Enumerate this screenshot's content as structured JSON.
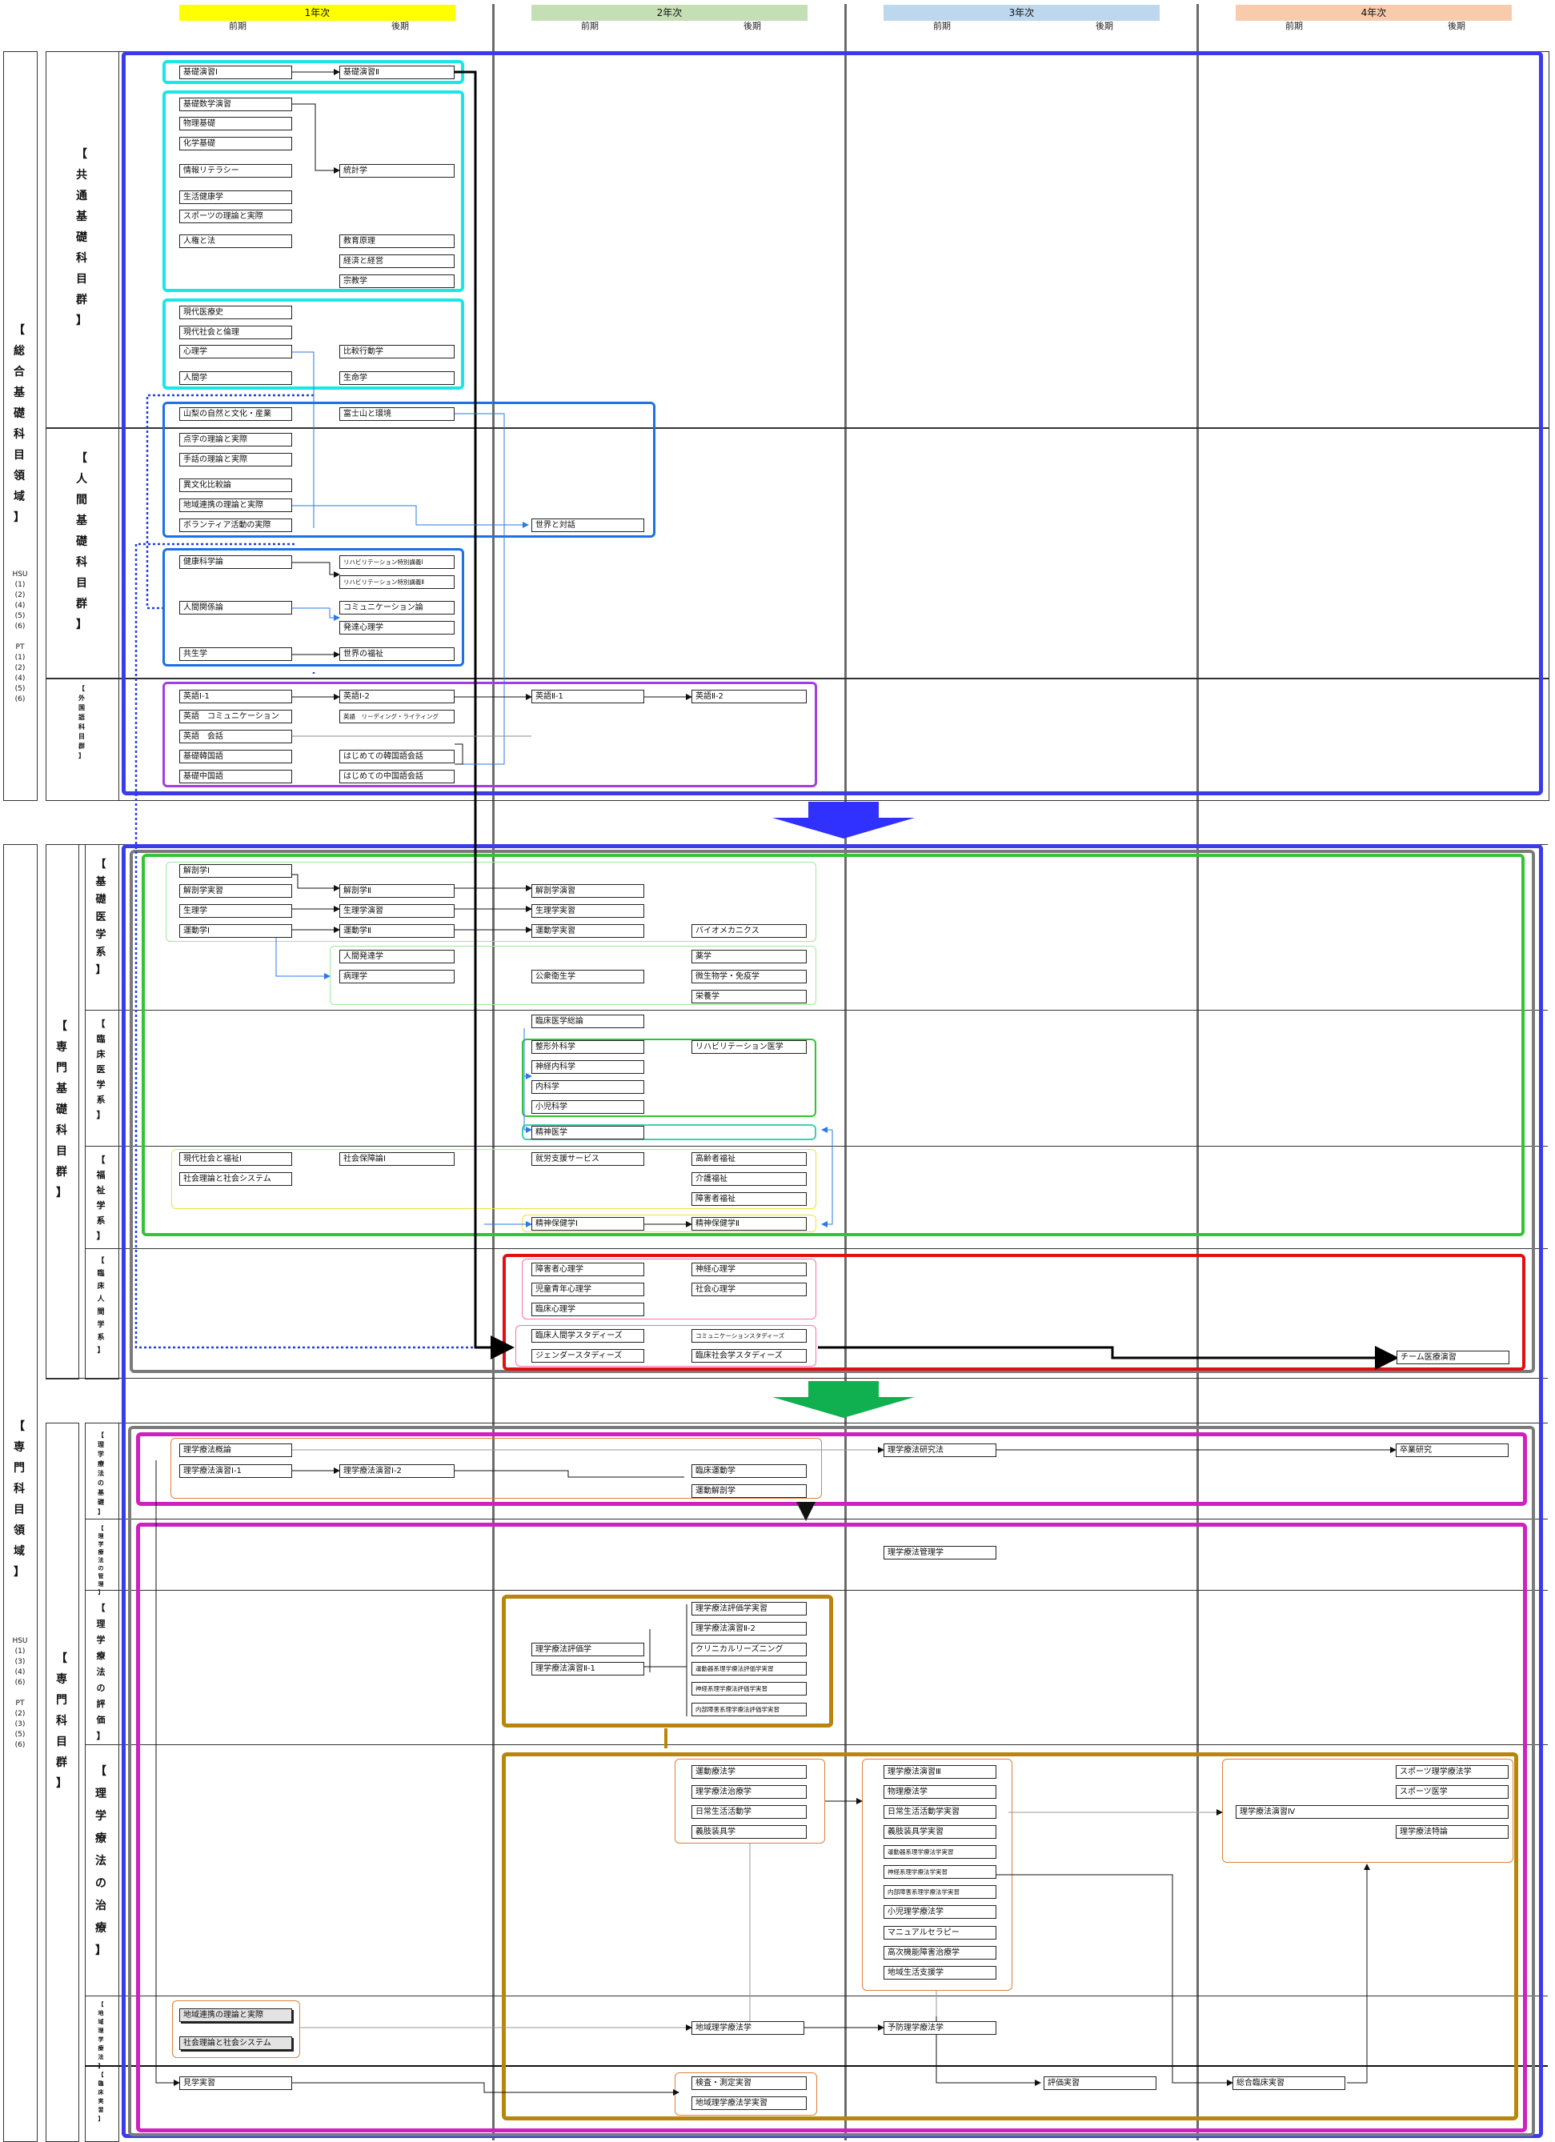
{
  "years": [
    {
      "label": "1年次",
      "color": "#ffff00",
      "sub1": "前期",
      "sub2": "後期"
    },
    {
      "label": "2年次",
      "color": "#c5dfb4",
      "sub1": "前期",
      "sub2": "後期"
    },
    {
      "label": "3年次",
      "color": "#bdd7ee",
      "sub1": "前期",
      "sub2": "後期"
    },
    {
      "label": "4年次",
      "color": "#f8cbad",
      "sub1": "前期",
      "sub2": "後期"
    }
  ],
  "domains": {
    "general": "【総合基礎科目領域】",
    "professional": "【専門科目領域】",
    "general_codes": "HSU\n(1)\n(2)\n(4)\n(5)\n(6)\n\nPT\n(1)\n(2)\n(4)\n(5)\n(6)",
    "professional_codes": "HSU\n(1)\n(3)\n(4)\n(6)\n\nPT\n(2)\n(3)\n(5)\n(6)"
  },
  "groups": {
    "common_basic": "【共通基礎科目群】",
    "human_basic": "【人間基礎科目群】",
    "foreign_lang": "【外国語科目群】",
    "prof_basic": "【専門基礎科目群】",
    "basic_medicine": "【基礎医学系】",
    "clinical_medicine": "【臨床医学系】",
    "welfare": "【福祉学系】",
    "clinical_human": "【臨床人間学系】",
    "prof_subjects": "【専門科目群】",
    "pt_basic": "【理学療法の基礎】",
    "pt_management": "【理学療法の管理】",
    "pt_evaluation": "【理学療法の評価】",
    "pt_treatment": "【理学療法の治療】",
    "community_pt": "【地域理学療法】",
    "clinical_practice": "【臨床実習】"
  },
  "courses": {
    "c1": "基礎演習Ⅰ",
    "c2": "基礎演習Ⅱ",
    "c3": "基礎数学演習",
    "c4": "物理基礎",
    "c5": "化学基礎",
    "c6": "情報リテラシー",
    "c7": "統計学",
    "c8": "生活健康学",
    "c9": "スポーツの理論と実際",
    "c10": "人権と法",
    "c11": "教育原理",
    "c12": "経済と経営",
    "c13": "宗教学",
    "c14": "現代医療史",
    "c15": "現代社会と倫理",
    "c16": "心理学",
    "c17": "比較行動学",
    "c18": "人間学",
    "c19": "生命学",
    "c20": "山梨の自然と文化・産業",
    "c21": "富士山と環境",
    "c22": "点字の理論と実際",
    "c23": "手話の理論と実際",
    "c24": "異文化比較論",
    "c25": "地域連携の理論と実際",
    "c26": "ボランティア活動の実際",
    "c27": "世界と対話",
    "c28": "健康科学論",
    "c29": "リハビリテーション特別講義Ⅰ",
    "c30": "リハビリテーション特別講義Ⅱ",
    "c31": "人間関係論",
    "c32": "コミュニケーション論",
    "c33": "発達心理学",
    "c34": "共生学",
    "c35": "世界の福祉",
    "c36": "英語Ⅰ-1",
    "c37": "英語Ⅰ-2",
    "c38": "英語Ⅱ-1",
    "c39": "英語Ⅱ-2",
    "c40": "英語　コミュニケーション",
    "c41": "英語　リーディング・ライティング",
    "c42": "英語　会話",
    "c43": "基礎韓国語",
    "c44": "はじめての韓国語会話",
    "c45": "基礎中国語",
    "c46": "はじめての中国語会話",
    "d1": "解剖学Ⅰ",
    "d2": "解剖学実習",
    "d3": "解剖学Ⅱ",
    "d4": "解剖学演習",
    "d5": "生理学",
    "d6": "生理学演習",
    "d7": "生理学実習",
    "d8": "運動学Ⅰ",
    "d9": "運動学Ⅱ",
    "d10": "運動学実習",
    "d11": "バイオメカニクス",
    "d12": "人間発達学",
    "d13": "薬学",
    "d14": "病理学",
    "d15": "公衆衛生学",
    "d16": "微生物学・免疫学",
    "d17": "栄養学",
    "d18": "臨床医学総論",
    "d19": "整形外科学",
    "d20": "リハビリテーション医学",
    "d21": "神経内科学",
    "d22": "内科学",
    "d23": "小児科学",
    "d24": "精神医学",
    "d25": "現代社会と福祉Ⅰ",
    "d26": "社会保障論Ⅰ",
    "d27": "就労支援サービス",
    "d28": "高齢者福祉",
    "d29": "社会理論と社会システム",
    "d30": "介護福祉",
    "d31": "障害者福祉",
    "d32": "精神保健学Ⅰ",
    "d33": "精神保健学Ⅱ",
    "d34": "障害者心理学",
    "d35": "神経心理学",
    "d36": "児童青年心理学",
    "d37": "社会心理学",
    "d38": "臨床心理学",
    "d39": "臨床人間学スタディーズ",
    "d40": "コミュニケーションスタディーズ",
    "d41": "ジェンダースタディーズ",
    "d42": "臨床社会学スタディーズ",
    "d43": "チーム医療演習",
    "e1": "理学療法概論",
    "e2": "理学療法研究法",
    "e3": "卒業研究",
    "e4": "理学療法演習Ⅰ-1",
    "e5": "理学療法演習Ⅰ-2",
    "e6": "臨床運動学",
    "e7": "運動解剖学",
    "e8": "理学療法管理学",
    "e9": "理学療法評価学実習",
    "e10": "理学療法演習Ⅱ-2",
    "e11": "クリニカルリーズニング",
    "e12": "理学療法評価学",
    "e13": "運動器系理学療法評価学実習",
    "e14": "理学療法演習Ⅱ-1",
    "e15": "神経系理学療法評価学実習",
    "e16": "内部障害系理学療法評価学実習",
    "e17": "運動療法学",
    "e18": "理学療法演習Ⅲ",
    "e19": "スポーツ理学療法学",
    "e20": "理学療法治療学",
    "e21": "物理療法学",
    "e22": "スポーツ医学",
    "e23": "日常生活活動学",
    "e24": "日常生活活動学実習",
    "e25": "理学療法演習Ⅳ",
    "e26": "義肢装具学",
    "e27": "義肢装具学実習",
    "e28": "理学療法特論",
    "e29": "運動器系理学療法学実習",
    "e30": "神経系理学療法学実習",
    "e31": "内部障害系理学療法学実習",
    "e32": "小児理学療法学",
    "e33": "マニュアルセラピー",
    "e34": "高次機能障害治療学",
    "e35": "地域生活支援学",
    "e36": "地域連携の理論と実際",
    "e37": "社会理論と社会システム",
    "e38": "地域理学療法学",
    "e39": "予防理学療法学",
    "e40": "見学実習",
    "e41": "検査・測定実習",
    "e42": "評価実習",
    "e43": "総合臨床実習",
    "e44": "地域理学療法学実習"
  },
  "colors": {
    "blue": "#3b3bea",
    "cyan": "#19e6e6",
    "mid_blue": "#1f6fe6",
    "purple": "#a040e0",
    "green": "#33c433",
    "light_green": "#9ee89e",
    "yellow": "#f0e040",
    "gray": "#7a7a7a",
    "red": "#e01010",
    "pink": "#ff6fa8",
    "magenta": "#d020c0",
    "gold": "#b8860b",
    "orange": "#e0803a",
    "arrow_blue": "#3030ff",
    "arrow_green": "#10b050"
  }
}
